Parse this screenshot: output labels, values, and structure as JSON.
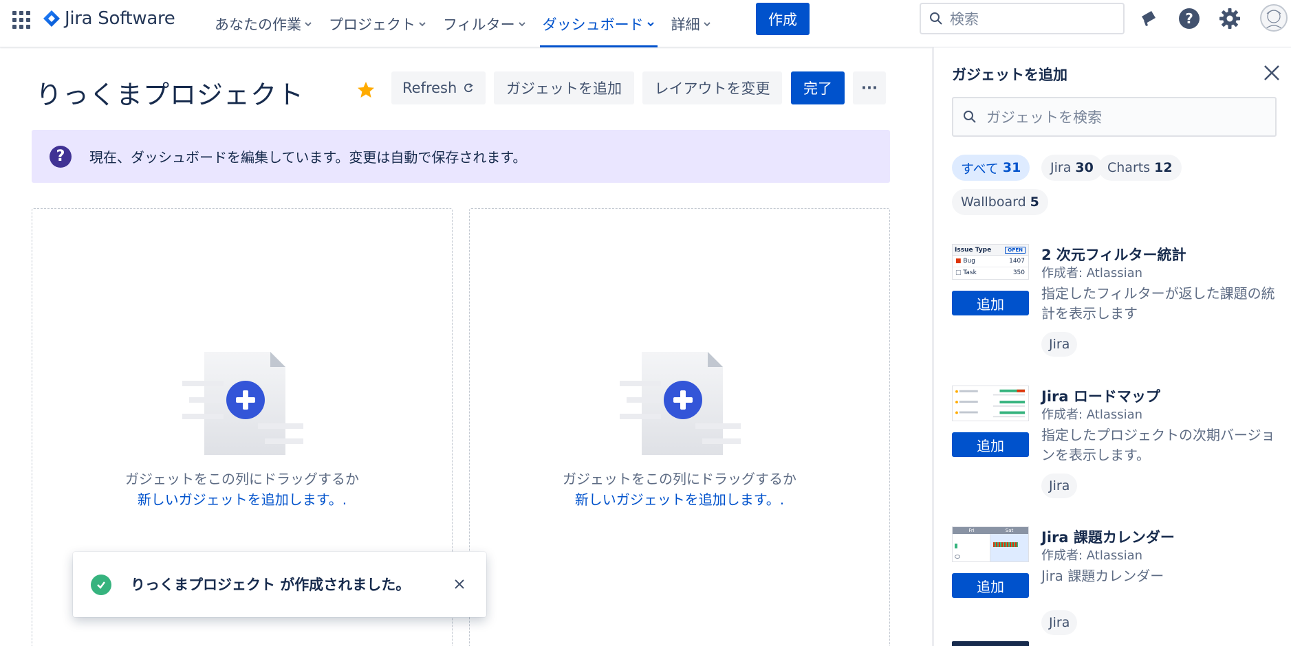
{
  "nav": {
    "logo": "Jira Software",
    "items": [
      {
        "label": "あなたの作業"
      },
      {
        "label": "プロジェクト"
      },
      {
        "label": "フィルター"
      },
      {
        "label": "ダッシュボード"
      },
      {
        "label": "詳細"
      }
    ],
    "active_item": "ダッシュボード",
    "create_label": "作成",
    "search_placeholder": "検索"
  },
  "dashboard": {
    "title": "りっくまプロジェクト",
    "refresh_label": "Refresh",
    "add_gadget_label": "ガジェットを追加",
    "change_layout_label": "レイアウトを変更",
    "done_label": "完了",
    "more_label": "···",
    "banner_text": "現在、ダッシュボードを編集しています。変更は自動で保存されます。",
    "columns": [
      {
        "drag_text": "ガジェットをこの列にドラッグするか",
        "add_link": "新しいガジェットを追加します。."
      },
      {
        "drag_text": "ガジェットをこの列にドラッグするか",
        "add_link": "新しいガジェットを追加します。."
      }
    ]
  },
  "toast": {
    "message": "りっくまプロジェクト が作成されました。"
  },
  "panel": {
    "title": "ガジェットを追加",
    "search_placeholder": "ガジェットを検索",
    "filters": [
      {
        "label": "すべて",
        "count": "31",
        "selected": true
      },
      {
        "label": "Jira",
        "count": "30",
        "selected": false
      },
      {
        "label": "Charts",
        "count": "12",
        "selected": false
      },
      {
        "label": "Wallboard",
        "count": "5",
        "selected": false
      }
    ],
    "add_label": "追加",
    "gadgets": [
      {
        "title": "2 次元フィルター統計",
        "author": "作成者: Atlassian",
        "description": "指定したフィルターが返した課題の統計を表示します",
        "tag": "Jira",
        "thumb": {
          "header": "Issue Type",
          "badge": "OPEN",
          "rows": [
            {
              "name": "Bug",
              "value": "1407"
            },
            {
              "name": "Task",
              "value": "350"
            }
          ]
        }
      },
      {
        "title": "Jira ロードマップ",
        "author": "作成者: Atlassian",
        "description": "指定したプロジェクトの次期バージョンを表示します。",
        "tag": "Jira"
      },
      {
        "title": "Jira 課題カレンダー",
        "author": "作成者: Atlassian",
        "description": "Jira 課題カレンダー",
        "tag": "Jira",
        "thumb": {
          "col1": "Fri",
          "col2": "Sat"
        }
      }
    ]
  },
  "colors": {
    "brand": "#0052cc",
    "banner_bg": "#eae6ff",
    "banner_icon": "#403294",
    "success": "#36b37e",
    "star": "#ffab00"
  }
}
